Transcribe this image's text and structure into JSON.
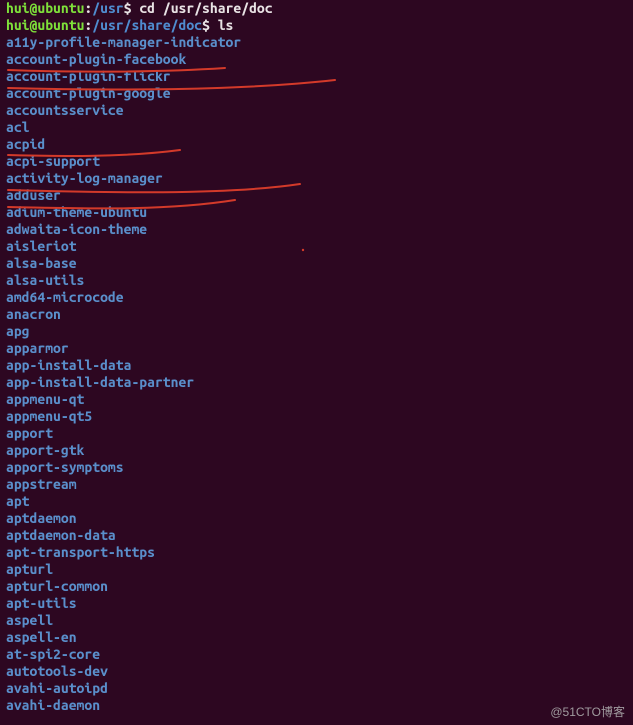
{
  "prompt1": {
    "user": "hui",
    "host": "ubuntu",
    "path": "/usr",
    "symbol": "$",
    "command": "cd /usr/share/doc"
  },
  "prompt2": {
    "user": "hui",
    "host": "ubuntu",
    "path": "/usr/share/doc",
    "symbol": "$",
    "command": "ls"
  },
  "entries": [
    "a11y-profile-manager-indicator",
    "account-plugin-facebook",
    "account-plugin-flickr",
    "account-plugin-google",
    "accountsservice",
    "acl",
    "acpid",
    "acpi-support",
    "activity-log-manager",
    "adduser",
    "adium-theme-ubuntu",
    "adwaita-icon-theme",
    "aisleriot",
    "alsa-base",
    "alsa-utils",
    "amd64-microcode",
    "anacron",
    "apg",
    "apparmor",
    "app-install-data",
    "app-install-data-partner",
    "appmenu-qt",
    "appmenu-qt5",
    "apport",
    "apport-gtk",
    "apport-symptoms",
    "appstream",
    "apt",
    "aptdaemon",
    "aptdaemon-data",
    "apt-transport-https",
    "apturl",
    "apturl-common",
    "apt-utils",
    "aspell",
    "aspell-en",
    "at-spi2-core",
    "autotools-dev",
    "avahi-autoipd",
    "avahi-daemon"
  ],
  "watermark": "@51CTO博客",
  "colors": {
    "background": "#2d0721",
    "user_host": "#7ee03a",
    "path_dir": "#5a8fcb",
    "text": "#e8e2e4",
    "annotation": "#d33a2a"
  }
}
